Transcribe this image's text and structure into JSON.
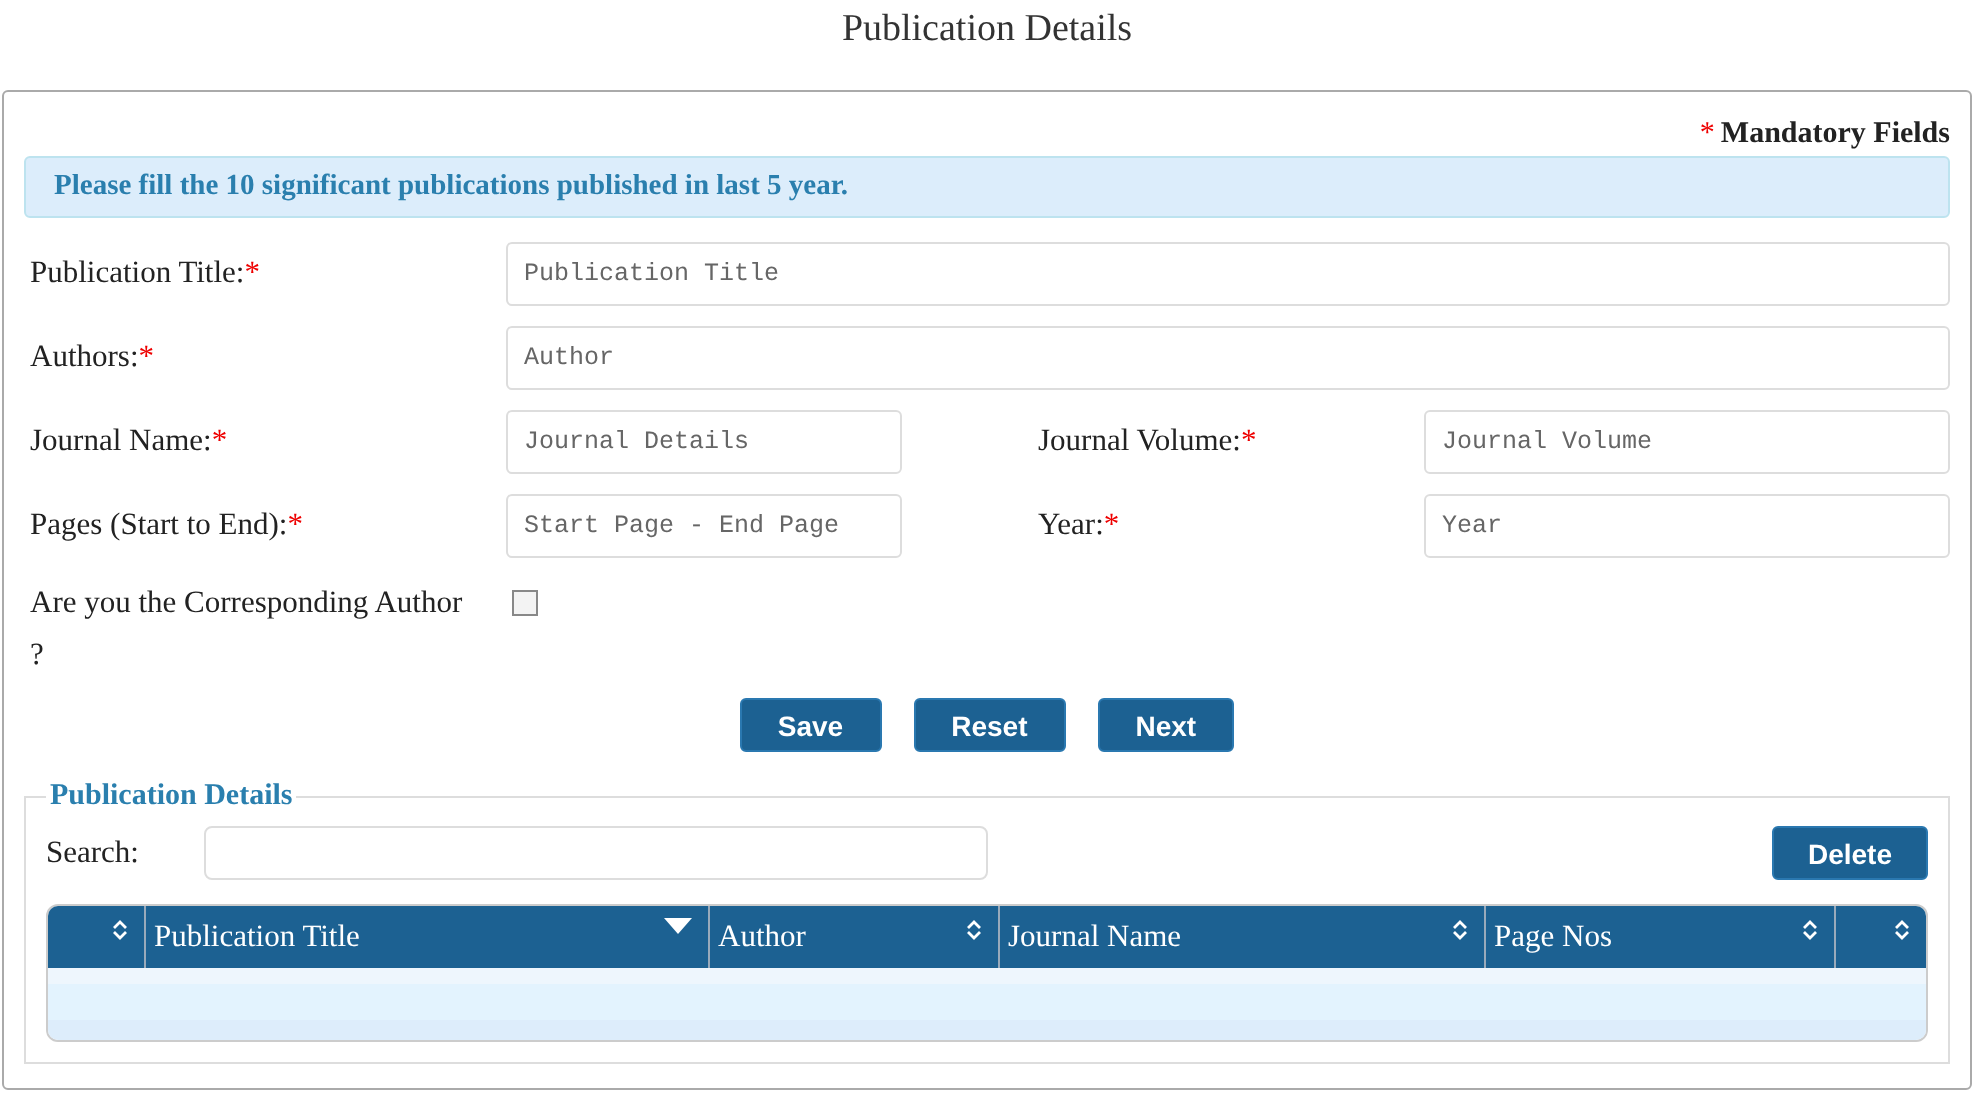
{
  "page_title": "Publication Details",
  "mandatory_note": {
    "mark": "*",
    "text": "Mandatory Fields"
  },
  "info_banner": "Please fill the 10 significant publications published in last 5 year.",
  "form_rows": [
    {
      "fields": [
        {
          "label": "Publication Title:",
          "required_mark": "*",
          "placeholder": "Publication Title"
        }
      ]
    },
    {
      "fields": [
        {
          "label": "Authors:",
          "required_mark": "*",
          "placeholder": "Author"
        }
      ]
    },
    {
      "fields": [
        {
          "label": "Journal Name:",
          "required_mark": "*",
          "placeholder": "Journal Details"
        },
        {
          "label": "Journal Volume:",
          "required_mark": "*",
          "placeholder": "Journal Volume"
        }
      ]
    },
    {
      "fields": [
        {
          "label": "Pages (Start to End):",
          "required_mark": "*",
          "placeholder": "Start Page - End Page"
        },
        {
          "label": "Year:",
          "required_mark": "*",
          "placeholder": "Year"
        }
      ]
    }
  ],
  "corresponding_author": {
    "label": "Are you the Corresponding Author ?",
    "checked": false
  },
  "buttons": [
    "Save",
    "Reset",
    "Next"
  ],
  "details": {
    "legend": "Publication Details",
    "search_label": "Search:",
    "delete_button": "Delete",
    "columns": [
      {
        "kind": "sortable"
      },
      {
        "label": "Publication Title",
        "kind": "sorted"
      },
      {
        "label": "Author",
        "kind": "sortable"
      },
      {
        "label": "Journal Name",
        "kind": "sortable"
      },
      {
        "label": "Page Nos",
        "kind": "sortable"
      },
      {
        "kind": "sortable"
      }
    ]
  }
}
